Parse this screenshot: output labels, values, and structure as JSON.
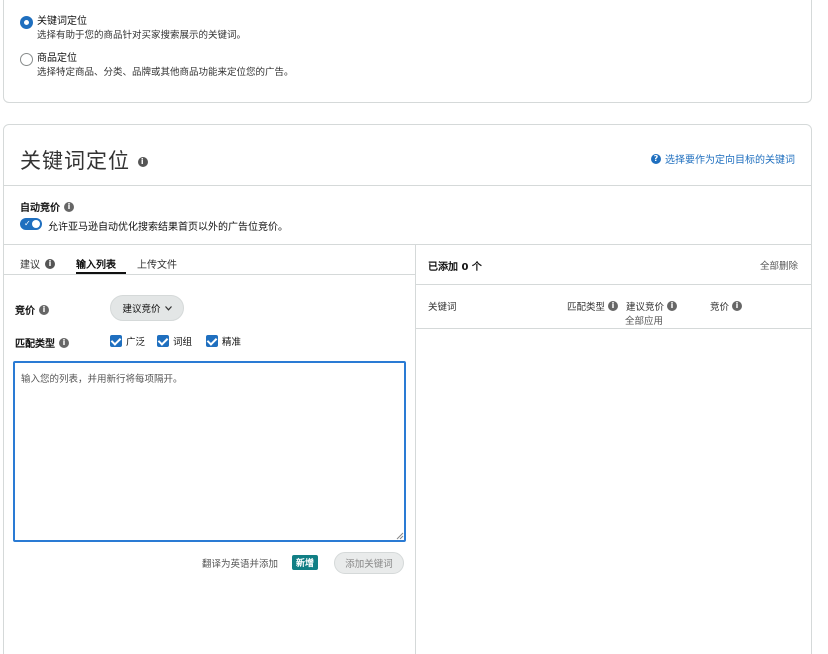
{
  "targeting": {
    "options": [
      {
        "label": "关键词定位",
        "description": "选择有助于您的商品针对买家搜索展示的关键词。",
        "selected": true
      },
      {
        "label": "商品定位",
        "description": "选择特定商品、分类、品牌或其他商品功能来定位您的广告。",
        "selected": false
      }
    ]
  },
  "keyword_section": {
    "title": "关键词定位",
    "header_link": "选择要作为定向目标的关键词"
  },
  "auto_bid": {
    "title": "自动竞价",
    "description": "允许亚马逊自动优化搜索结果首页以外的广告位竞价。",
    "enabled": true
  },
  "tabs": [
    {
      "label": "建议",
      "active": false
    },
    {
      "label": "输入列表",
      "active": true
    },
    {
      "label": "上传文件",
      "active": false
    }
  ],
  "bid": {
    "label": "竞价",
    "button_label": "建议竞价"
  },
  "match_type": {
    "label": "匹配类型",
    "options": [
      {
        "label": "广泛",
        "checked": true
      },
      {
        "label": "词组",
        "checked": true
      },
      {
        "label": "精准",
        "checked": true
      }
    ]
  },
  "keyword_input": {
    "placeholder": "输入您的列表，并用新行将每项隔开。"
  },
  "actions": {
    "translate_label": "翻译为英语并添加",
    "new_badge": "新增",
    "add_button": "添加关键词"
  },
  "added_panel": {
    "title": "已添加 0 个",
    "remove_all": "全部删除",
    "columns": {
      "keyword": "关键词",
      "match_type": "匹配类型",
      "suggested_bid": "建议竞价",
      "apply_all": "全部应用",
      "bid": "竞价"
    }
  },
  "colors": {
    "accent": "#1f6fbf",
    "new_badge": "#117f85",
    "border": "#d5d9d9"
  }
}
